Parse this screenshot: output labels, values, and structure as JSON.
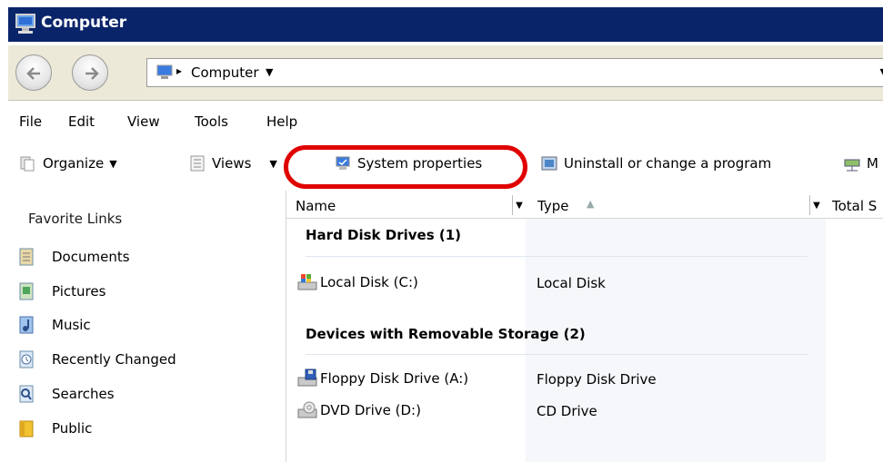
{
  "window": {
    "title": "Computer"
  },
  "address": {
    "crumb": "Computer",
    "crumb_sep": "▸"
  },
  "menu": [
    "File",
    "Edit",
    "View",
    "Tools",
    "Help"
  ],
  "toolbar": {
    "organize": "Organize",
    "views": "Views",
    "system_properties": "System properties",
    "uninstall": "Uninstall or change a program",
    "map_partial": "M"
  },
  "favorites": {
    "title": "Favorite Links",
    "items": [
      "Documents",
      "Pictures",
      "Music",
      "Recently Changed",
      "Searches",
      "Public"
    ]
  },
  "columns": {
    "name": "Name",
    "type": "Type",
    "total": "Total S"
  },
  "groups": [
    {
      "label": "Hard Disk Drives (1)",
      "items": [
        {
          "name": "Local Disk (C:)",
          "type": "Local Disk"
        }
      ]
    },
    {
      "label": "Devices with Removable Storage (2)",
      "items": [
        {
          "name": "Floppy Disk Drive (A:)",
          "type": "Floppy Disk Drive"
        },
        {
          "name": "DVD Drive (D:)",
          "type": "CD Drive"
        }
      ]
    }
  ],
  "colors": {
    "titlebar": "#0a246a",
    "highlight": "#e00000"
  }
}
